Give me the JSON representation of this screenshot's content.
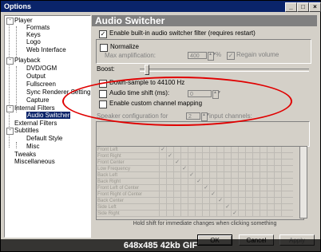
{
  "window": {
    "title": "Options",
    "controls": [
      "_",
      "□",
      "×"
    ]
  },
  "tree": {
    "items": [
      {
        "label": "Player",
        "level": 0,
        "expander": "-"
      },
      {
        "label": "Formats",
        "level": 1
      },
      {
        "label": "Keys",
        "level": 1
      },
      {
        "label": "Logo",
        "level": 1
      },
      {
        "label": "Web Interface",
        "level": 1
      },
      {
        "label": "Playback",
        "level": 0,
        "expander": "-"
      },
      {
        "label": "DVD/OGM",
        "level": 1
      },
      {
        "label": "Output",
        "level": 1
      },
      {
        "label": "Fullscreen",
        "level": 1
      },
      {
        "label": "Sync Renderer Settings",
        "level": 1
      },
      {
        "label": "Capture",
        "level": 1
      },
      {
        "label": "Internal Filters",
        "level": 0,
        "expander": "-"
      },
      {
        "label": "Audio Switcher",
        "level": 1,
        "selected": true
      },
      {
        "label": "External Filters",
        "level": 0
      },
      {
        "label": "Subtitles",
        "level": 0,
        "expander": "-"
      },
      {
        "label": "Default Style",
        "level": 1
      },
      {
        "label": "Misc",
        "level": 1
      },
      {
        "label": "Tweaks",
        "level": 0
      },
      {
        "label": "Miscellaneous",
        "level": 0
      }
    ]
  },
  "panel": {
    "header": "Audio Switcher",
    "enable_label": "Enable built-in audio switcher filter (requires restart)",
    "normalize_label": "Normalize",
    "max_amp_label": "Max amplification:",
    "max_amp_value": "400",
    "max_amp_unit": "%",
    "regain_label": "Regain volume",
    "boost_label": "Boost:",
    "downsample_label": "Down-sample to 44100 Hz",
    "timeshift_label": "Audio time shift (ms):",
    "timeshift_value": "0",
    "custom_mapping_label": "Enable custom channel mapping",
    "speaker_config_label": "Speaker configuration for",
    "speaker_config_value": "2",
    "input_channels_label": "input channels:",
    "matrix_rows": [
      "Front Left",
      "Front Right",
      "Front Center",
      "Low Frequency",
      "Back Left",
      "Back Right",
      "Front Left of Center",
      "Front Right of Center",
      "Back Center",
      "Side Left",
      "Side Right"
    ],
    "hint": "Hold shift for immediate changes when clicking something"
  },
  "buttons": {
    "ok": "OK",
    "cancel": "Cancel",
    "apply": "Apply"
  },
  "caption": "648x485 42kb GIF",
  "colors": {
    "title_bg": "#0a246a",
    "panel_bg": "#d4d0c8",
    "highlight": "#e00000"
  }
}
